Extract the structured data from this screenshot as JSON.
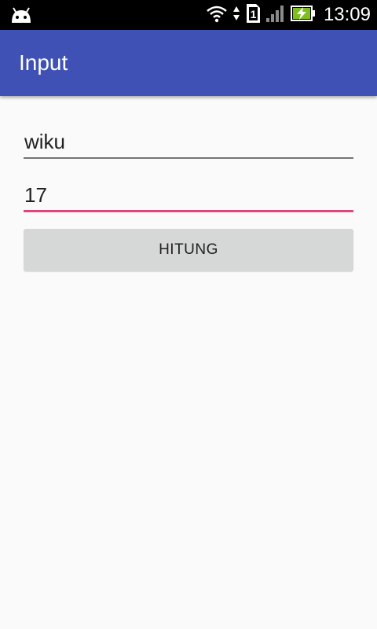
{
  "status_bar": {
    "time": "13:09",
    "icons": [
      "android-icon",
      "wifi-icon",
      "data-arrows-icon",
      "sim-icon",
      "signal-icon",
      "battery-charging-icon"
    ],
    "sim_label": "1"
  },
  "app_bar": {
    "title": "Input",
    "color": "#3f51b5"
  },
  "form": {
    "field1_value": "wiku",
    "field2_value": "17",
    "focused_underline_color": "#e0457a",
    "button_label": "HITUNG"
  }
}
